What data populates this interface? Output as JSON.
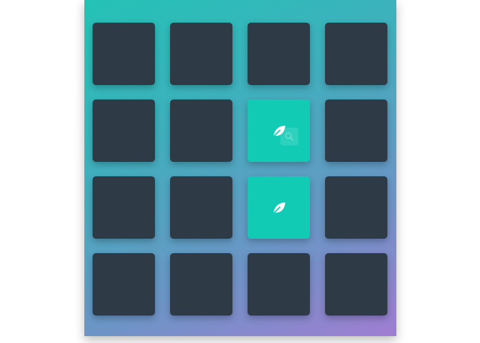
{
  "game": {
    "rows": 4,
    "columns": 4,
    "cards": [
      {
        "state": "hidden",
        "icon": ""
      },
      {
        "state": "hidden",
        "icon": ""
      },
      {
        "state": "hidden",
        "icon": ""
      },
      {
        "state": "hidden",
        "icon": ""
      },
      {
        "state": "hidden",
        "icon": ""
      },
      {
        "state": "hidden",
        "icon": ""
      },
      {
        "state": "revealed",
        "icon": "leaf-icon"
      },
      {
        "state": "hidden",
        "icon": ""
      },
      {
        "state": "hidden",
        "icon": ""
      },
      {
        "state": "hidden",
        "icon": ""
      },
      {
        "state": "revealed",
        "icon": "leaf-icon"
      },
      {
        "state": "hidden",
        "icon": ""
      },
      {
        "state": "hidden",
        "icon": ""
      },
      {
        "state": "hidden",
        "icon": ""
      },
      {
        "state": "hidden",
        "icon": ""
      },
      {
        "state": "hidden",
        "icon": ""
      }
    ],
    "colors": {
      "card_hidden": "#2e3b47",
      "card_revealed": "#12cbb5",
      "background_top": "#24c2b6",
      "background_bottom": "#a07dd2"
    }
  }
}
